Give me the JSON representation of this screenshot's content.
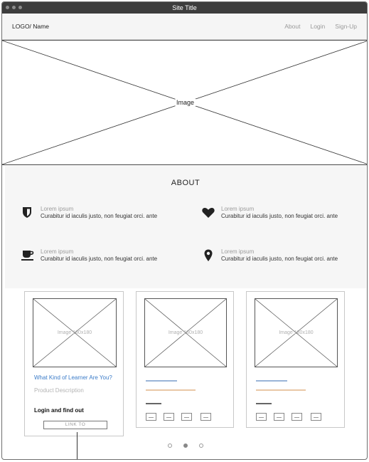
{
  "window": {
    "title": "Site Title"
  },
  "nav": {
    "logo": "LOGO/ Name",
    "links": [
      "About",
      "Login",
      "Sign-Up"
    ]
  },
  "hero": {
    "label": "Image"
  },
  "about": {
    "title": "ABOUT",
    "features": [
      {
        "icon": "shield-icon",
        "title": "Lorem ipsum",
        "desc": "Curabitur id iaculis justo, non feugiat orci. ante"
      },
      {
        "icon": "heart-icon",
        "title": "Lorem ipsum",
        "desc": "Curabitur id iaculis justo, non feugiat orci. ante"
      },
      {
        "icon": "coffee-cup-icon",
        "title": "Lorem ipsum",
        "desc": "Curabitur id iaculis justo, non feugiat orci. ante"
      },
      {
        "icon": "map-pin-icon",
        "title": "Lorem ipsum",
        "desc": "Curabitur id iaculis justo, non feugiat orci. ante"
      }
    ]
  },
  "cards": [
    {
      "image_label": "Image 180x180",
      "link": "What Kind of Learner Are You?",
      "description": "Product Description",
      "login_text": "Login and find out",
      "button_label": "LINK TO"
    },
    {
      "image_label": "Image 180x180"
    },
    {
      "image_label": "Image 180x180"
    }
  ],
  "pager": {
    "count": 3,
    "active": 2
  },
  "colors": {
    "link": "#3a7bc8",
    "titlebar": "#3d3d3d",
    "section_bg": "#f6f6f6"
  }
}
